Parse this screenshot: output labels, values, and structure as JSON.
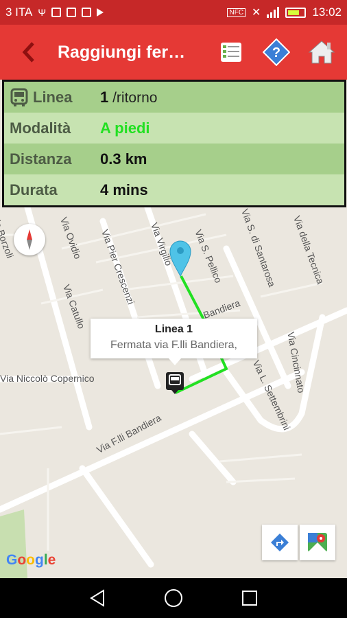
{
  "status_bar": {
    "carrier": "3 ITA",
    "time": "13:02"
  },
  "app_bar": {
    "title": "Raggiungi fer…",
    "icons": [
      "back-arrow-icon",
      "list-icon",
      "help-icon",
      "home-icon"
    ]
  },
  "info": {
    "rows": [
      {
        "label": "Linea",
        "value": "1",
        "sub": " /ritorno",
        "icon": "bus-icon"
      },
      {
        "label": "Modalità",
        "value": "A piedi"
      },
      {
        "label": "Distanza",
        "value": "0.3 km"
      },
      {
        "label": "Durata",
        "value": "4 mins"
      }
    ],
    "colors": {
      "mode_value": "#22e022",
      "panel_bg": "#c7e3b1",
      "row_bg": "#a6cf8b"
    }
  },
  "map": {
    "streets": {
      "borzoli": "Via Borzoli",
      "ovidio": "Via Ovidio",
      "pier_crescenzi": "Via Pier Crescenzi",
      "virgilio": "Via Virgilio",
      "pellico": "Via S. Pellico",
      "santarosa": "Via S. di Santarosa",
      "tecnica": "Via della Tecnica",
      "catullo": "Via Catullo",
      "bandiera_north": "Bandiera",
      "settembrini": "Via L. Settembrini",
      "cincinnato": "Via Cincinnato",
      "copernico": "Via Niccolò Copernico",
      "bandiera": "Via F.lli Bandiera"
    },
    "callout": {
      "title": "Linea 1",
      "subtitle": "Fermata via F.lli Bandiera,"
    },
    "route_color": "#22e022",
    "google": "Google"
  },
  "nav": [
    "back-nav-icon",
    "home-nav-icon",
    "recents-nav-icon"
  ]
}
